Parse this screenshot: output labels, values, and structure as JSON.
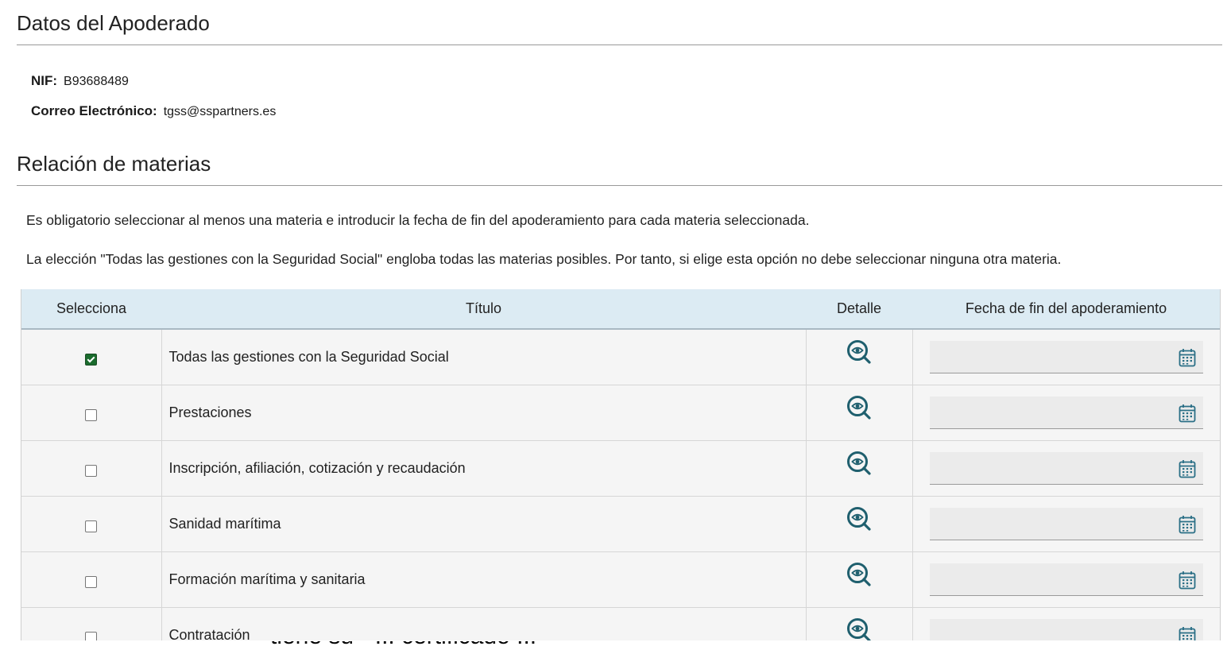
{
  "apoderado": {
    "title": "Datos del Apoderado",
    "nif_label": "NIF:",
    "nif_value": "B93688489",
    "email_label": "Correo Electrónico:",
    "email_value": "tgss@sspartners.es"
  },
  "materias": {
    "title": "Relación de materias",
    "note1": "Es obligatorio seleccionar al menos una materia e introducir la fecha de fin del apoderamiento para cada materia seleccionada.",
    "note2": "La elección \"Todas las gestiones con la Seguridad Social\" engloba todas las materias posibles. Por tanto, si elige esta opción no debe seleccionar ninguna otra materia.",
    "columns": {
      "select": "Selecciona",
      "title": "Título",
      "detail": "Detalle",
      "end_date": "Fecha de fin del apoderamiento"
    },
    "rows": [
      {
        "title": "Todas las gestiones con la Seguridad Social",
        "checked": true,
        "date": ""
      },
      {
        "title": "Prestaciones",
        "checked": false,
        "date": ""
      },
      {
        "title": "Inscripción, afiliación, cotización y recaudación",
        "checked": false,
        "date": ""
      },
      {
        "title": "Sanidad marítima",
        "checked": false,
        "date": ""
      },
      {
        "title": "Formación marítima y sanitaria",
        "checked": false,
        "date": ""
      },
      {
        "title": "Contratación",
        "checked": false,
        "date": ""
      }
    ]
  },
  "overlay": {
    "partial_text": "tiene su “ ... certificado ...”"
  },
  "colors": {
    "header_bg": "#dcebf3",
    "icon_teal": "#1f5f6e",
    "checkbox_checked": "#1a6b2d",
    "highlight": "#f5f20f"
  },
  "icons": [
    "view-detail-icon",
    "calendar-icon"
  ]
}
